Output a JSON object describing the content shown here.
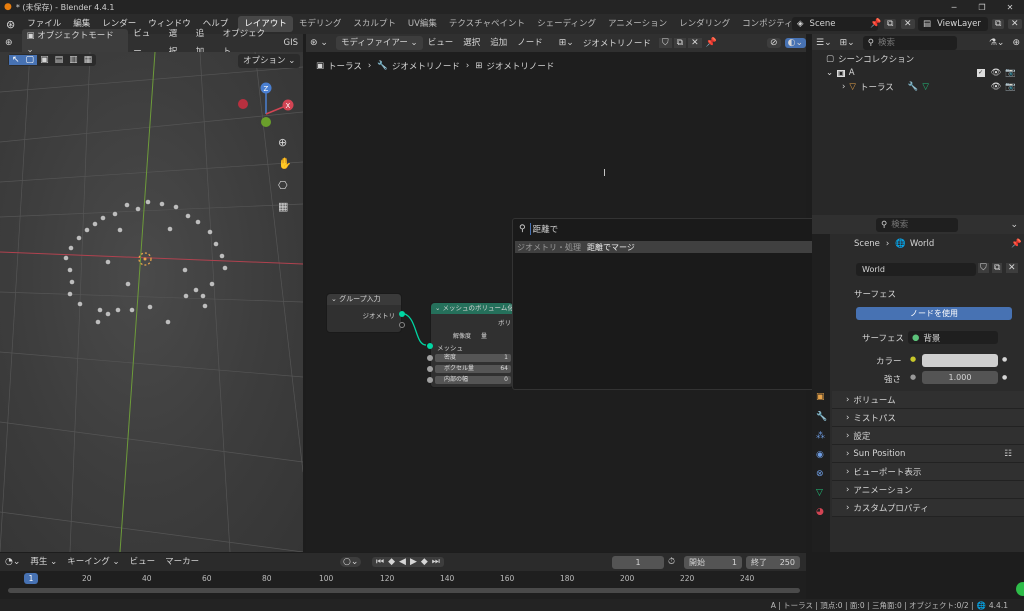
{
  "window": {
    "title": "* (未保存) - Blender 4.4.1"
  },
  "menu": {
    "items": [
      "ファイル",
      "編集",
      "レンダー",
      "ウィンドウ",
      "ヘルプ"
    ],
    "workspaces": [
      "レイアウト",
      "モデリング",
      "スカルプト",
      "UV編集",
      "テクスチャペイント",
      "シェーディング",
      "アニメーション",
      "レンダリング",
      "コンポジティング"
    ],
    "scene": "Scene",
    "view_layer": "ViewLayer"
  },
  "viewport": {
    "mode": "オブジェクトモード",
    "menus": [
      "ビュー",
      "選択",
      "追加",
      "オブジェクト",
      "GIS"
    ],
    "options": "オプション"
  },
  "node_editor": {
    "editor_type": "モディファイアー",
    "menus": [
      "ビュー",
      "選択",
      "追加",
      "ノード"
    ],
    "tree_name": "ジオメトリノード",
    "breadcrumb": [
      "トーラス",
      "ジオメトリノード",
      "ジオメトリノード"
    ],
    "group_input": {
      "title": "グループ入力",
      "output": "ジオメトリ"
    },
    "volume_node": {
      "title": "メッシュのボリューム化",
      "output": "ボリ",
      "resolution_label": "解像度",
      "resolution_value": "量",
      "mesh": "メッシュ",
      "fields": [
        {
          "label": "密度",
          "value": "1"
        },
        {
          "label": "ボクセル量",
          "value": "64"
        },
        {
          "label": "内部の幅",
          "value": "0"
        }
      ]
    },
    "search": {
      "query": "距離で",
      "result_category": "ジオメトリ・処理",
      "result_item": "距離でマージ"
    }
  },
  "outliner": {
    "search_placeholder": "検索",
    "collection": "シーンコレクション",
    "sub_collection": "A",
    "object": "トーラス"
  },
  "properties": {
    "search_placeholder": "検索",
    "breadcrumb_scene": "Scene",
    "breadcrumb_world": "World",
    "world_name": "World",
    "surface_panel": "サーフェス",
    "use_nodes": "ノードを使用",
    "surface_label": "サーフェス",
    "surface_value": "背景",
    "color_label": "カラー",
    "strength_label": "強さ",
    "strength_value": "1.000",
    "panels": [
      "ボリューム",
      "ミストパス",
      "設定",
      "Sun Position",
      "ビューポート表示",
      "アニメーション",
      "カスタムプロパティ"
    ]
  },
  "timeline": {
    "menus": [
      "再生",
      "キーイング",
      "ビュー",
      "マーカー"
    ],
    "current_frame": "1",
    "start_label": "開始",
    "start": "1",
    "end_label": "終了",
    "end": "250",
    "ticks": [
      "1",
      "20",
      "40",
      "60",
      "80",
      "100",
      "120",
      "140",
      "160",
      "180",
      "200",
      "220",
      "240"
    ]
  },
  "status": {
    "text": "A | トーラス | 頂点:0 | 面:0 | 三角面:0 | オブジェクト:0/2 |",
    "version": "4.4.1"
  },
  "colors": {
    "accent": "#4772b3",
    "node_header": "#25705b",
    "link": "#00d6a3"
  }
}
